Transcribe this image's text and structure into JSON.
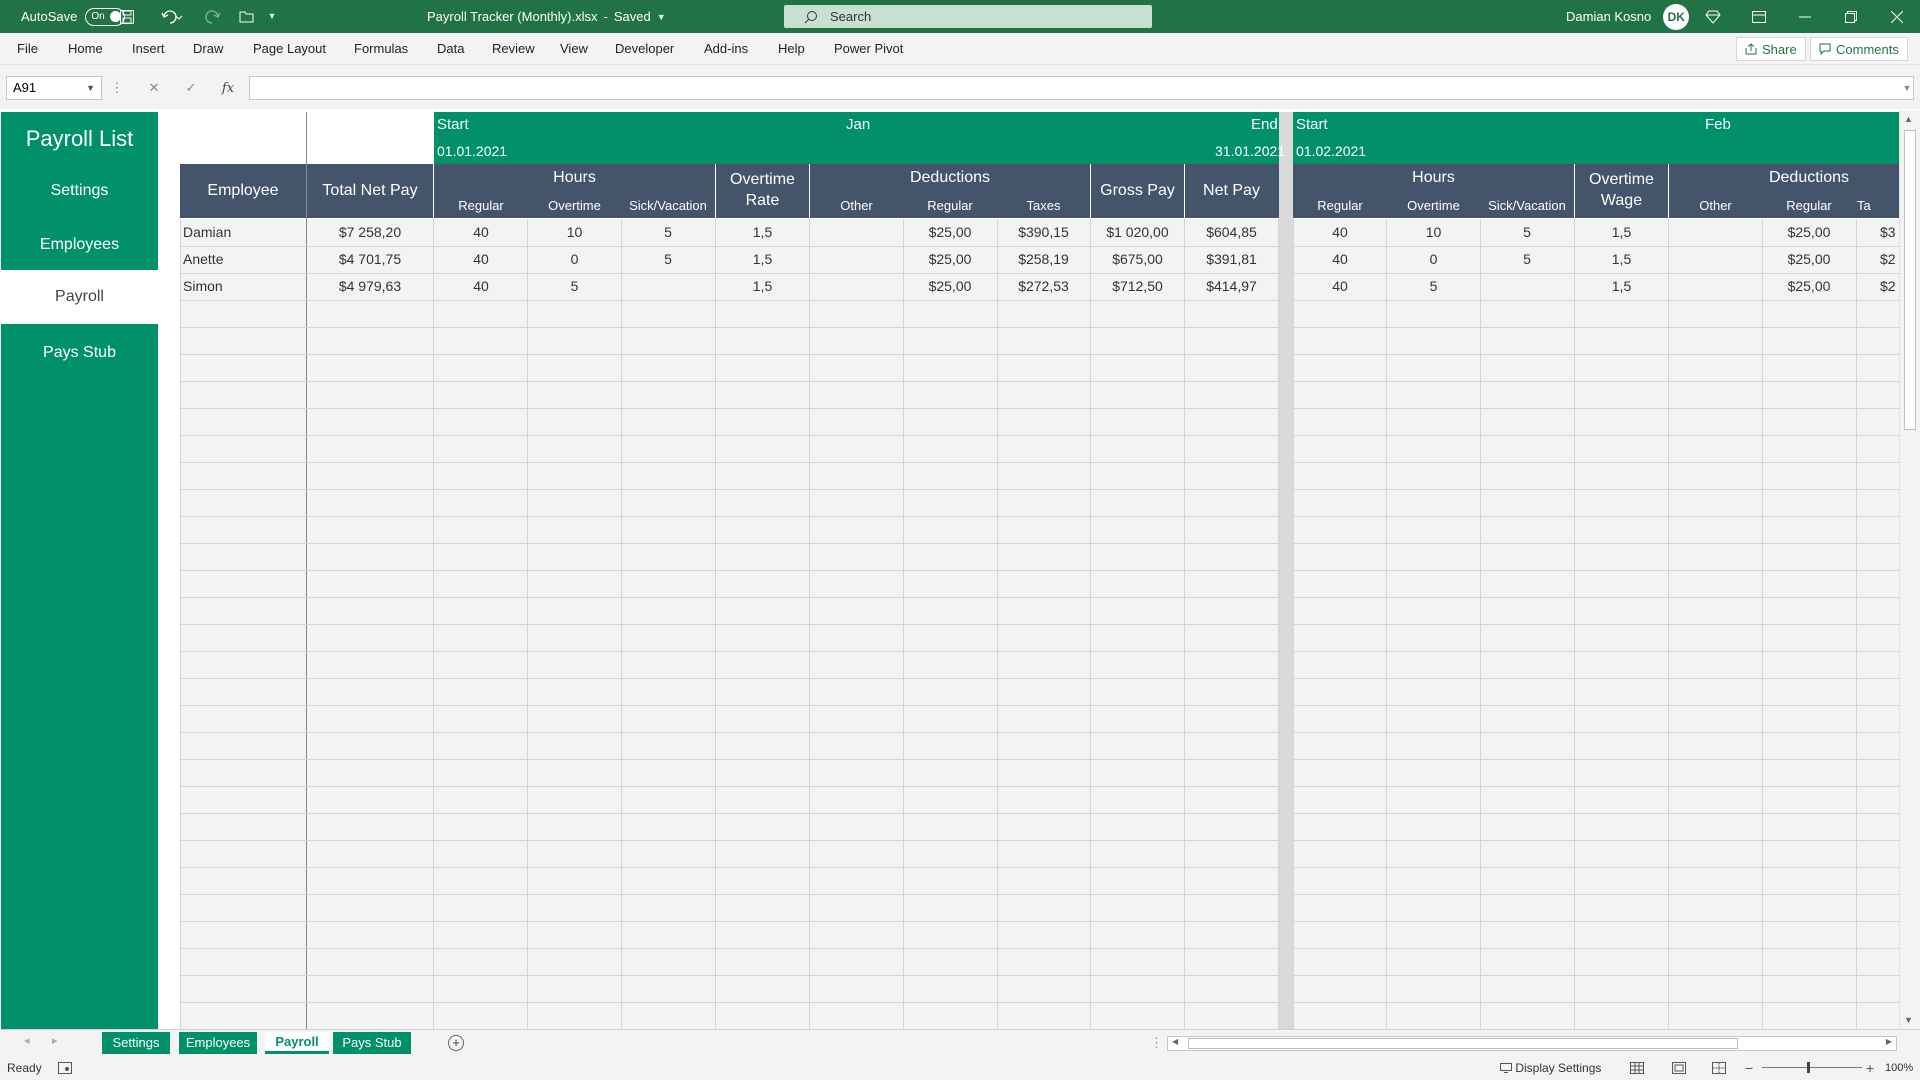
{
  "window": {
    "autosave_label": "AutoSave",
    "autosave_state": "On",
    "file_title": "Payroll Tracker (Monthly).xlsx",
    "save_status": "Saved",
    "search_placeholder": "Search",
    "user_name": "Damian Kosno"
  },
  "menu": {
    "items": [
      "File",
      "Home",
      "Insert",
      "Draw",
      "Page Layout",
      "Formulas",
      "Data",
      "Review",
      "View",
      "Developer",
      "Add-ins",
      "Help",
      "Power Pivot"
    ],
    "share_label": "Share",
    "comments_label": "Comments"
  },
  "formula_bar": {
    "cell_ref": "A91",
    "fx_label": "fx",
    "formula": ""
  },
  "sidebar": {
    "title": "Payroll List",
    "items": [
      "Settings",
      "Employees",
      "Payroll",
      "Pays Stub"
    ],
    "active": "Payroll"
  },
  "sheet": {
    "months": [
      {
        "name": "Jan",
        "start_label": "Start",
        "start_date": "01.01.2021",
        "end_label": "End",
        "end_date": "31.01.2021"
      },
      {
        "name": "Feb",
        "start_label": "Start",
        "start_date": "01.02.2021"
      }
    ],
    "headers": {
      "employee": "Employee",
      "total_net_pay": "Total Net Pay",
      "hours": "Hours",
      "regular": "Regular",
      "overtime": "Overtime",
      "sick_vacation": "Sick/Vacation",
      "overtime_rate": "Overtime Rate",
      "overtime_wage": "Overtime Wage",
      "deductions": "Deductions",
      "other": "Other",
      "ded_regular": "Regular",
      "taxes": "Taxes",
      "taxes_cut": "Ta",
      "gross_pay": "Gross Pay",
      "net_pay": "Net Pay"
    },
    "rows": [
      {
        "employee": "Damian",
        "total_net_pay": "$7 258,20",
        "jan": [
          "40",
          "10",
          "5",
          "1,5",
          "",
          "$25,00",
          "$390,15",
          "$1 020,00",
          "$604,85"
        ],
        "feb": [
          "40",
          "10",
          "5",
          "1,5",
          "",
          "$25,00",
          "$3"
        ]
      },
      {
        "employee": "Anette",
        "total_net_pay": "$4 701,75",
        "jan": [
          "40",
          "0",
          "5",
          "1,5",
          "",
          "$25,00",
          "$258,19",
          "$675,00",
          "$391,81"
        ],
        "feb": [
          "40",
          "0",
          "5",
          "1,5",
          "",
          "$25,00",
          "$2"
        ]
      },
      {
        "employee": "Simon",
        "total_net_pay": "$4 979,63",
        "jan": [
          "40",
          "5",
          "",
          "1,5",
          "",
          "$25,00",
          "$272,53",
          "$712,50",
          "$414,97"
        ],
        "feb": [
          "40",
          "5",
          "",
          "1,5",
          "",
          "$25,00",
          "$2"
        ]
      }
    ]
  },
  "tabs": [
    "Settings",
    "Employees",
    "Payroll",
    "Pays Stub"
  ],
  "active_tab": "Payroll",
  "status": {
    "ready": "Ready",
    "display_settings": "Display Settings",
    "zoom": "100%"
  },
  "colors": {
    "excel_green": "#217346",
    "accent": "#00906a",
    "header_slate": "#44546a",
    "grid_row": "#f2f3f5"
  }
}
